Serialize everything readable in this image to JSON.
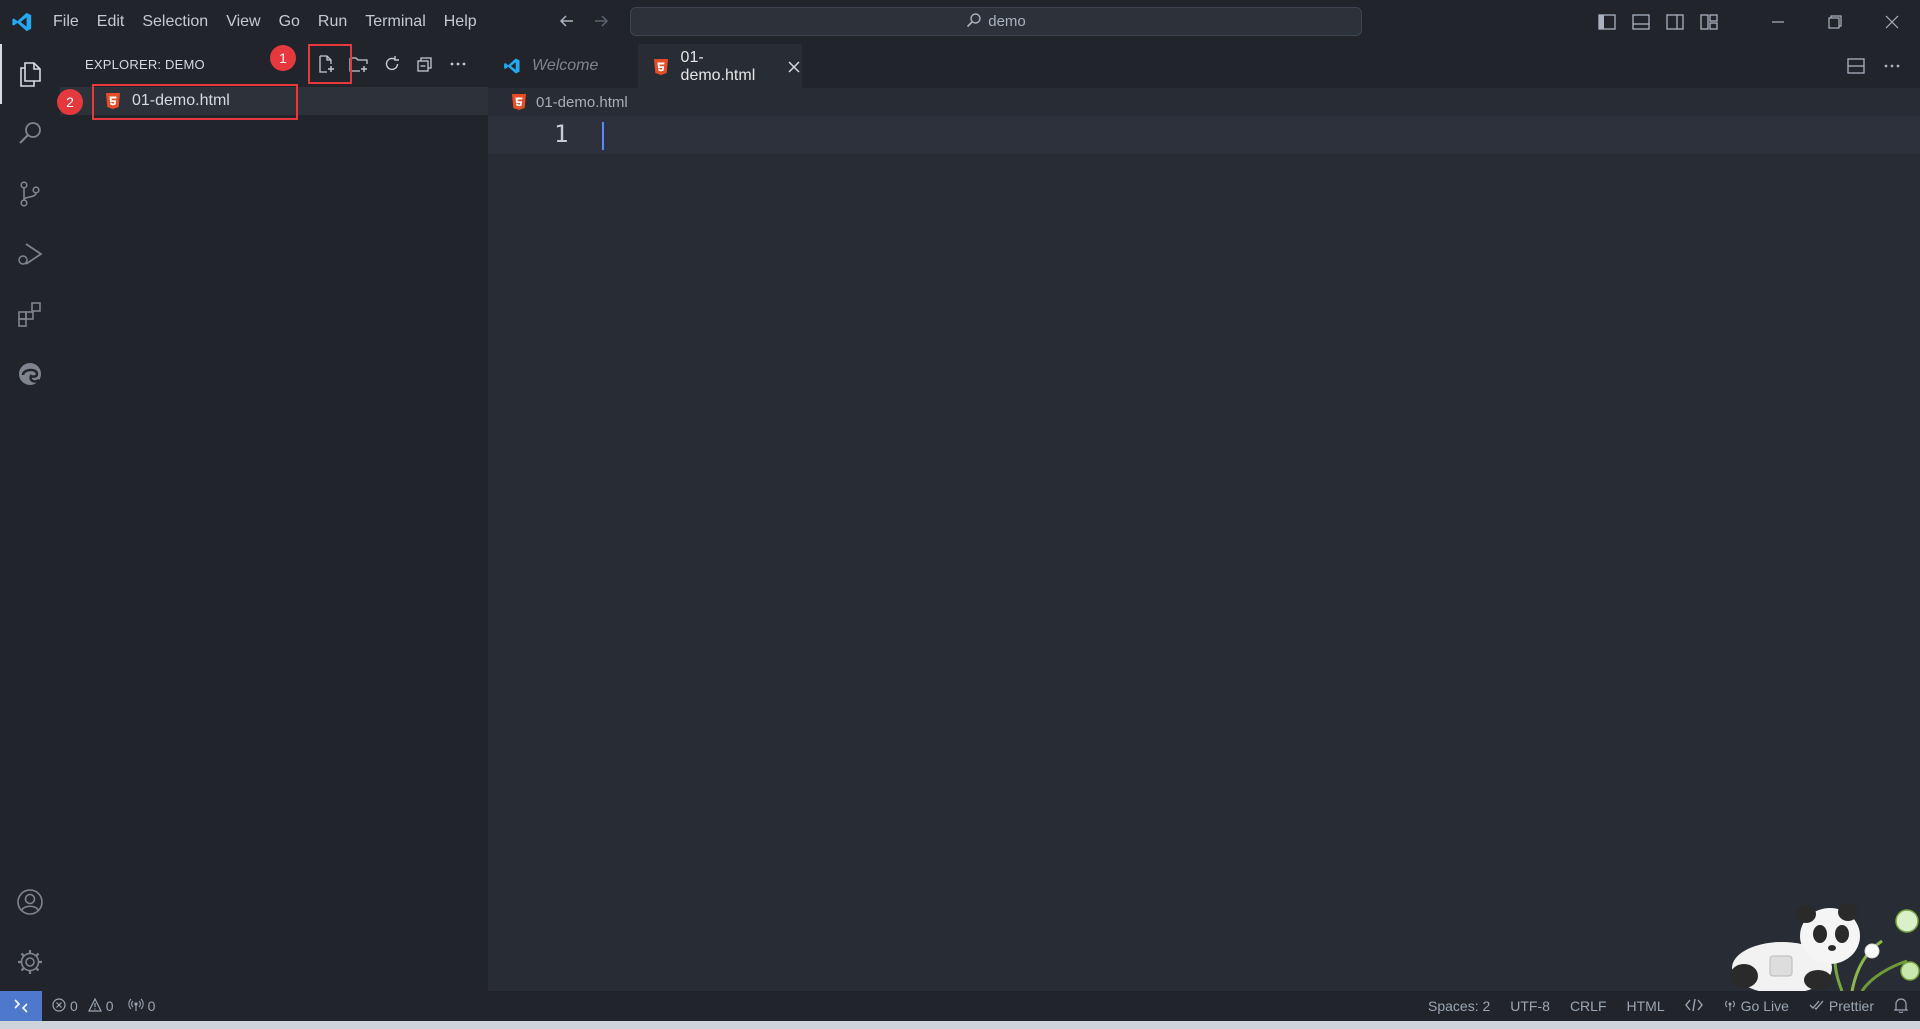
{
  "menu": [
    "File",
    "Edit",
    "Selection",
    "View",
    "Go",
    "Run",
    "Terminal",
    "Help"
  ],
  "command_center": {
    "text": "demo"
  },
  "sidebar": {
    "title": "EXPLORER: DEMO",
    "files": [
      {
        "name": "01-demo.html"
      }
    ]
  },
  "annotations": {
    "badge1": "1",
    "badge2": "2"
  },
  "tabs": [
    {
      "label": "Welcome",
      "active": false
    },
    {
      "label": "01-demo.html",
      "active": true
    }
  ],
  "breadcrumb": "01-demo.html",
  "editor": {
    "line_numbers": [
      "1"
    ]
  },
  "statusbar": {
    "errors": "0",
    "warnings": "0",
    "ports": "0",
    "spaces": "Spaces: 2",
    "encoding": "UTF-8",
    "eol": "CRLF",
    "language": "HTML",
    "go_live": "Go Live",
    "prettier": "Prettier"
  },
  "colors": {
    "accent": "#4d78cc",
    "highlight": "#e5393d",
    "html_icon": "#e44d26",
    "vscode_blue": "#23a9f2"
  }
}
